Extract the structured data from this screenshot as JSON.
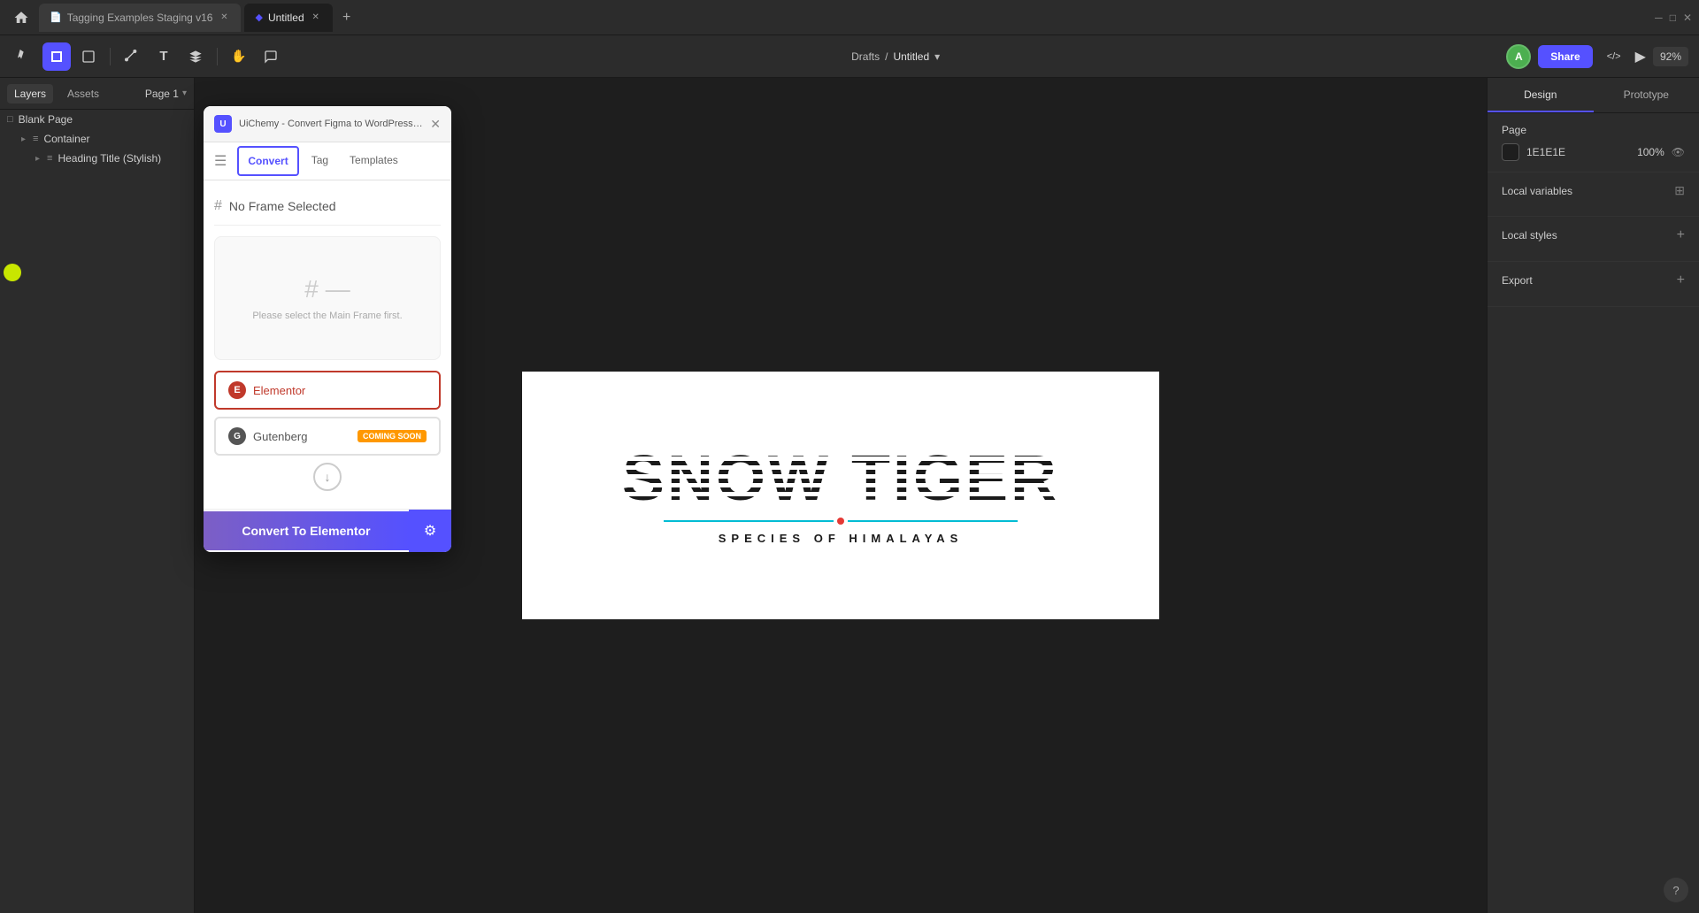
{
  "titlebar": {
    "tabs": [
      {
        "id": "tab-tagging",
        "label": "Tagging Examples Staging v16",
        "active": false
      },
      {
        "id": "tab-untitled",
        "label": "Untitled",
        "active": true
      }
    ],
    "add_tab_label": "+",
    "home_icon": "⌂"
  },
  "toolbar": {
    "move_tool": "▶",
    "frame_tool": "#",
    "shape_tool": "□",
    "vector_tool": "✒",
    "text_tool": "T",
    "components_tool": "❖",
    "hand_tool": "✋",
    "comment_tool": "💬",
    "location": "Drafts",
    "separator": "/",
    "file_name": "Untitled",
    "dropdown_icon": "▾",
    "share_label": "Share",
    "code_icon": "</>",
    "play_icon": "▶",
    "zoom_level": "92%",
    "avatar_letter": "A",
    "help_icon": "?"
  },
  "left_panel": {
    "tabs": [
      {
        "label": "Layers",
        "active": true
      },
      {
        "label": "Assets",
        "active": false
      }
    ],
    "page_label": "Page 1",
    "layers": [
      {
        "label": "Blank Page",
        "icon": "□",
        "indent": 0,
        "expand": ""
      },
      {
        "label": "Container",
        "icon": "≡",
        "indent": 1,
        "expand": "▸"
      },
      {
        "label": "Heading Title (Stylish)",
        "icon": "≡",
        "indent": 2,
        "expand": "▸"
      }
    ]
  },
  "right_panel": {
    "tabs": [
      {
        "label": "Design",
        "active": true
      },
      {
        "label": "Prototype",
        "active": false
      }
    ],
    "page_section": {
      "title": "Page",
      "color_value": "1E1E1E",
      "opacity": "100%",
      "eye_icon": "👁"
    },
    "local_variables": {
      "title": "Local variables",
      "icon": "⊞"
    },
    "local_styles": {
      "title": "Local styles",
      "add_icon": "+"
    },
    "export": {
      "title": "Export",
      "add_icon": "+"
    }
  },
  "plugin": {
    "logo_text": "U",
    "title": "UiChemy - Convert Figma to WordPress ( Elemento...",
    "close_icon": "✕",
    "menu_icon": "☰",
    "tabs": [
      {
        "label": "Convert",
        "active": true
      },
      {
        "label": "Tag",
        "active": false
      },
      {
        "label": "Templates",
        "active": false
      }
    ],
    "no_frame_text": "No Frame Selected",
    "placeholder_text": "Please select the Main Frame first.",
    "elementor_label": "Elementor",
    "gutenberg_label": "Gutenberg",
    "soon_badge": "COMING SOON",
    "scroll_icon": "↓",
    "convert_btn": "Convert To Elementor",
    "settings_icon": "⚙"
  },
  "canvas": {
    "title_line1": "SNOW TIGER",
    "subtitle": "SPECIES OF HIMALAYAS"
  }
}
